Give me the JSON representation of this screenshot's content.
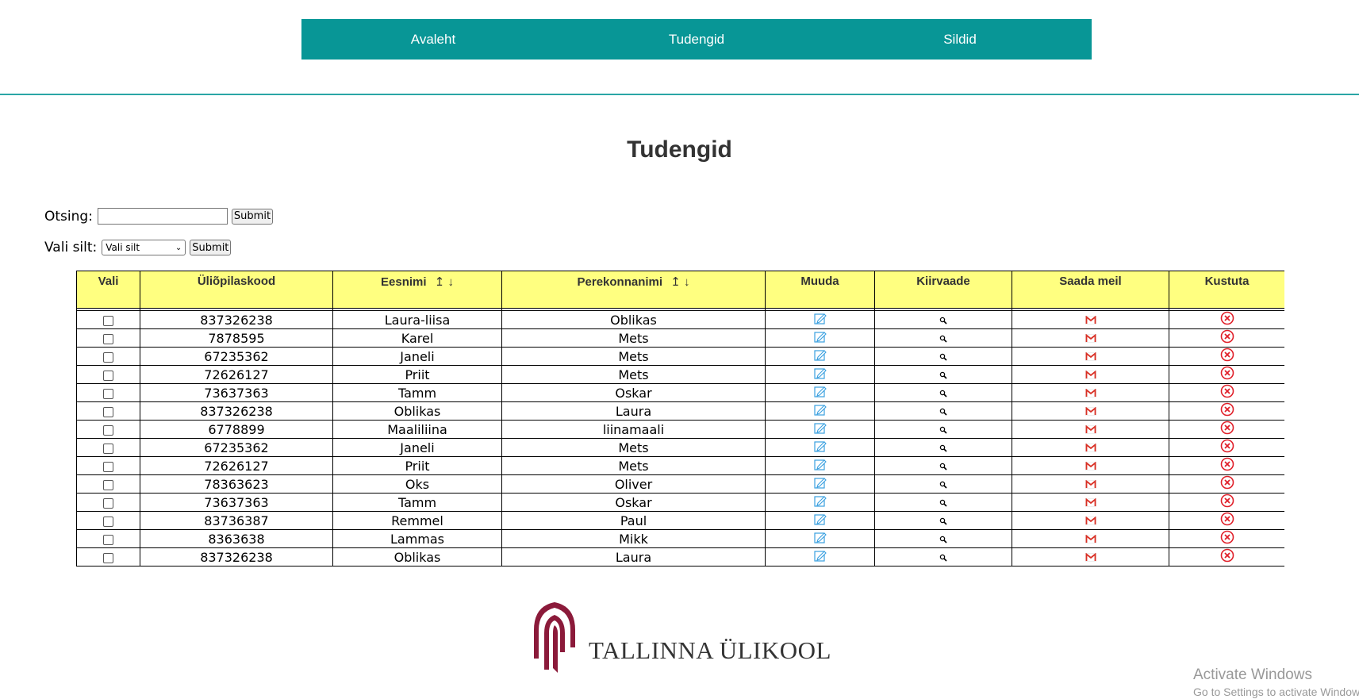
{
  "nav": {
    "items": [
      "Avaleht",
      "Tudengid",
      "Sildid"
    ]
  },
  "page": {
    "title": "Tudengid"
  },
  "search": {
    "label": "Otsing:",
    "value": "",
    "submit": "Submit"
  },
  "tag_filter": {
    "label": "Vali silt:",
    "selected": "Vali silt",
    "submit": "Submit"
  },
  "table": {
    "headers": {
      "select": "Vali",
      "code": "Üliõpilaskood",
      "first_name": "Eesnimi",
      "last_name": "Perekonnanimi",
      "edit": "Muuda",
      "preview": "Kiirvaade",
      "email": "Saada meil",
      "delete": "Kustuta"
    },
    "sort_symbols": {
      "up": "↥",
      "down": "↓"
    },
    "rows": [
      {
        "code": "837326238",
        "first_name": "Laura-liisa",
        "last_name": "Oblikas"
      },
      {
        "code": "7878595",
        "first_name": "Karel",
        "last_name": "Mets"
      },
      {
        "code": "67235362",
        "first_name": "Janeli",
        "last_name": "Mets"
      },
      {
        "code": "72626127",
        "first_name": "Priit",
        "last_name": "Mets"
      },
      {
        "code": "73637363",
        "first_name": "Tamm",
        "last_name": "Oskar"
      },
      {
        "code": "837326238",
        "first_name": "Oblikas",
        "last_name": "Laura"
      },
      {
        "code": "6778899",
        "first_name": "Maaliliina",
        "last_name": "liinamaali"
      },
      {
        "code": "67235362",
        "first_name": "Janeli",
        "last_name": "Mets"
      },
      {
        "code": "72626127",
        "first_name": "Priit",
        "last_name": "Mets"
      },
      {
        "code": "78363623",
        "first_name": "Oks",
        "last_name": "Oliver"
      },
      {
        "code": "73637363",
        "first_name": "Tamm",
        "last_name": "Oskar"
      },
      {
        "code": "83736387",
        "first_name": "Remmel",
        "last_name": "Paul"
      },
      {
        "code": "8363638",
        "first_name": "Lammas",
        "last_name": "Mikk"
      },
      {
        "code": "837326238",
        "first_name": "Oblikas",
        "last_name": "Laura"
      }
    ],
    "icons": {
      "edit": "edit-icon",
      "preview": "magnifier-icon",
      "email": "gmail-icon",
      "delete": "delete-x-icon"
    }
  },
  "footer": {
    "logo_text": "TALLINNA ÜLIKOOL",
    "logo_icon": "tlu-arch-logo"
  },
  "watermark": {
    "line1": "Activate Windows",
    "line2": "Go to Settings to activate Windows."
  },
  "colors": {
    "nav_bg": "#089696",
    "header_bg": "#ffff80",
    "logo": "#8b1a3a"
  }
}
